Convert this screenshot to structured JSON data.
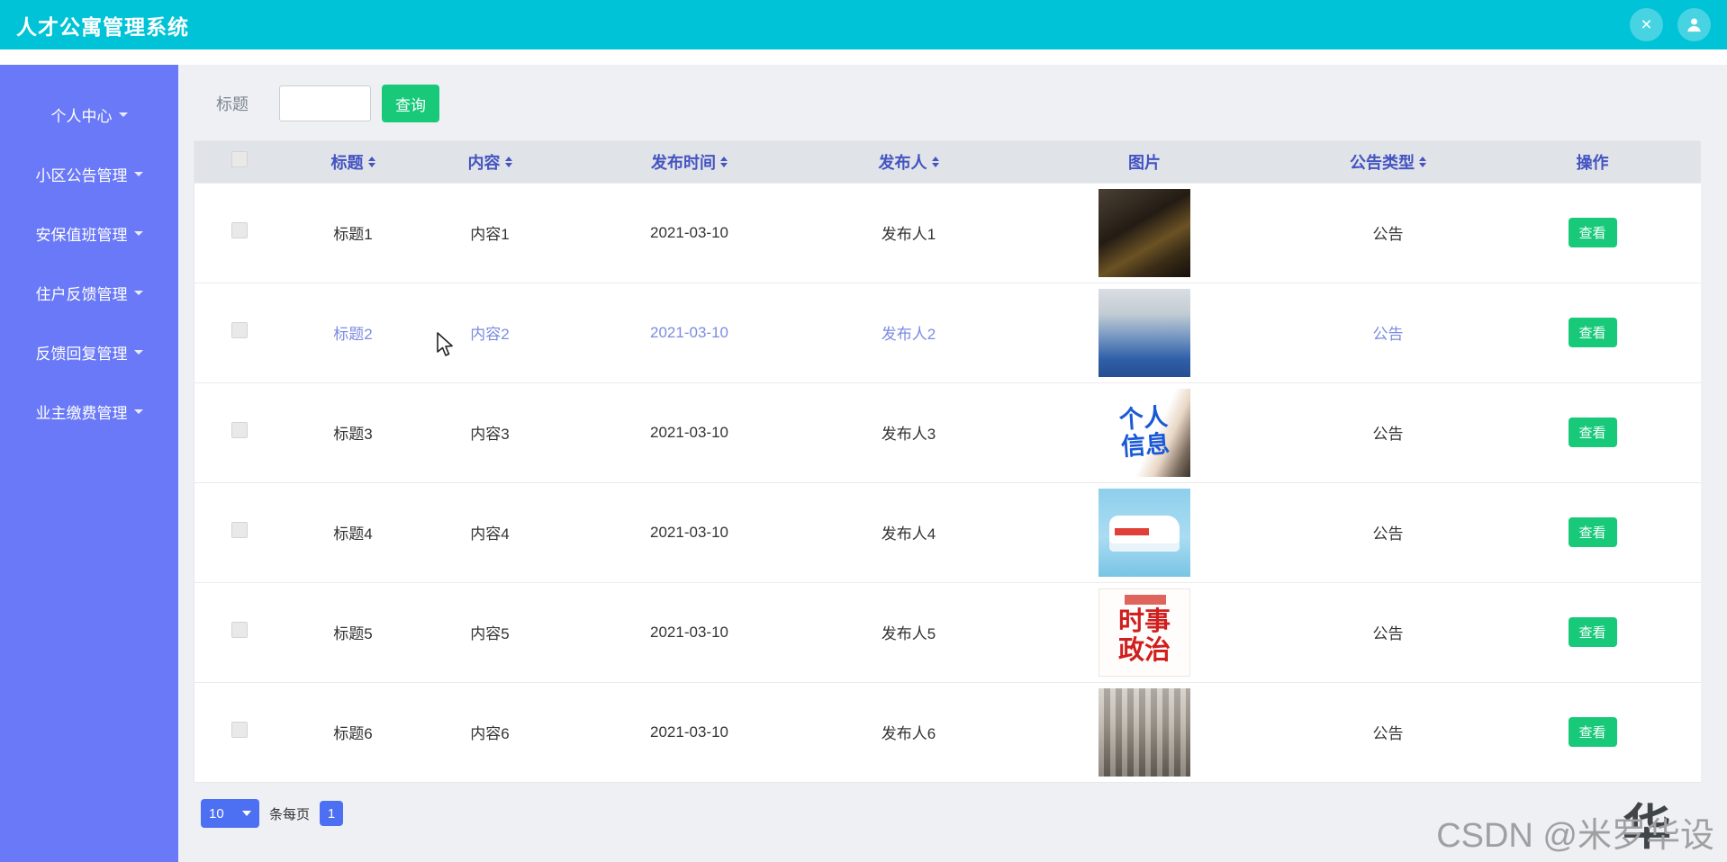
{
  "header": {
    "title": "人才公寓管理系统"
  },
  "sidebar": {
    "items": [
      {
        "label": "个人中心"
      },
      {
        "label": "小区公告管理"
      },
      {
        "label": "安保值班管理"
      },
      {
        "label": "住户反馈管理"
      },
      {
        "label": "反馈回复管理"
      },
      {
        "label": "业主缴费管理"
      }
    ]
  },
  "toolbar": {
    "search_label": "标题",
    "search_value": "",
    "search_button": "查询"
  },
  "table": {
    "highlighted_row": 1,
    "columns": [
      {
        "label": "标题",
        "sortable": true
      },
      {
        "label": "内容",
        "sortable": true
      },
      {
        "label": "发布时间",
        "sortable": true
      },
      {
        "label": "发布人",
        "sortable": true
      },
      {
        "label": "图片",
        "sortable": false
      },
      {
        "label": "公告类型",
        "sortable": true
      },
      {
        "label": "操作",
        "sortable": false
      }
    ],
    "rows": [
      {
        "title": "标题1",
        "content": "内容1",
        "date": "2021-03-10",
        "publisher": "发布人1",
        "image": "statue-photo",
        "type": "公告",
        "action": "查看"
      },
      {
        "title": "标题2",
        "content": "内容2",
        "date": "2021-03-10",
        "publisher": "发布人2",
        "image": "medical-worker-photo",
        "type": "公告",
        "action": "查看"
      },
      {
        "title": "标题3",
        "content": "内容3",
        "date": "2021-03-10",
        "publisher": "发布人3",
        "image": "personal-info-graphic",
        "image_text": "个人信息",
        "type": "公告",
        "action": "查看"
      },
      {
        "title": "标题4",
        "content": "内容4",
        "date": "2021-03-10",
        "publisher": "发布人4",
        "image": "ambulance-illustration",
        "type": "公告",
        "action": "查看"
      },
      {
        "title": "标题5",
        "content": "内容5",
        "date": "2021-03-10",
        "publisher": "发布人5",
        "image": "current-politics-cover",
        "image_text": "时事政治",
        "type": "公告",
        "action": "查看"
      },
      {
        "title": "标题6",
        "content": "内容6",
        "date": "2021-03-10",
        "publisher": "发布人6",
        "image": "library-photo",
        "type": "公告",
        "action": "查看"
      }
    ]
  },
  "pagination": {
    "page_size": "10",
    "per_page_label": "条每页",
    "current_page": "1"
  },
  "watermark": {
    "text": "CSDN @米罗华设",
    "logo": "华"
  },
  "colors": {
    "header_bg": "#00c3d7",
    "sidebar_bg": "#6a79f7",
    "accent_blue": "#4454c2",
    "button_green": "#18c97a",
    "pagination_blue": "#4d6ff2",
    "highlight_text": "#7b8ce0"
  }
}
